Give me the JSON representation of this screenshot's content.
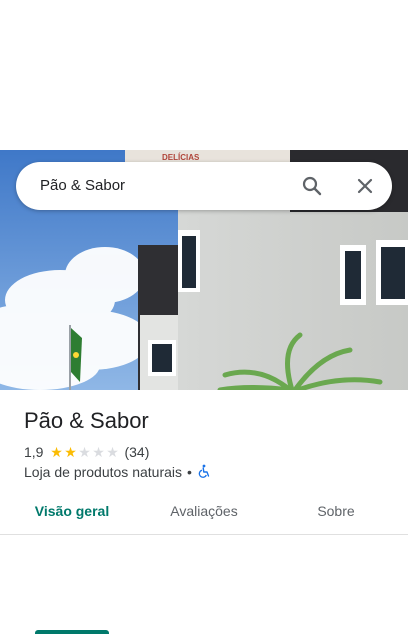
{
  "search": {
    "query": "Pão & Sabor"
  },
  "place": {
    "name": "Pão & Sabor",
    "rating": "1,9",
    "stars_filled": 2,
    "stars_total": 5,
    "review_count": "(34)",
    "category": "Loja de produtos naturais",
    "separator": "•",
    "accessibility_icon": "wheelchair-icon"
  },
  "hero_image": {
    "sign_text": "DELÍCIAS"
  },
  "tabs": [
    {
      "label": "Visão geral",
      "active": true
    },
    {
      "label": "Avaliações",
      "active": false
    },
    {
      "label": "Sobre",
      "active": false
    }
  ],
  "colors": {
    "accent": "#00796b",
    "star": "#fbbc04",
    "accessibility": "#1a73e8"
  }
}
